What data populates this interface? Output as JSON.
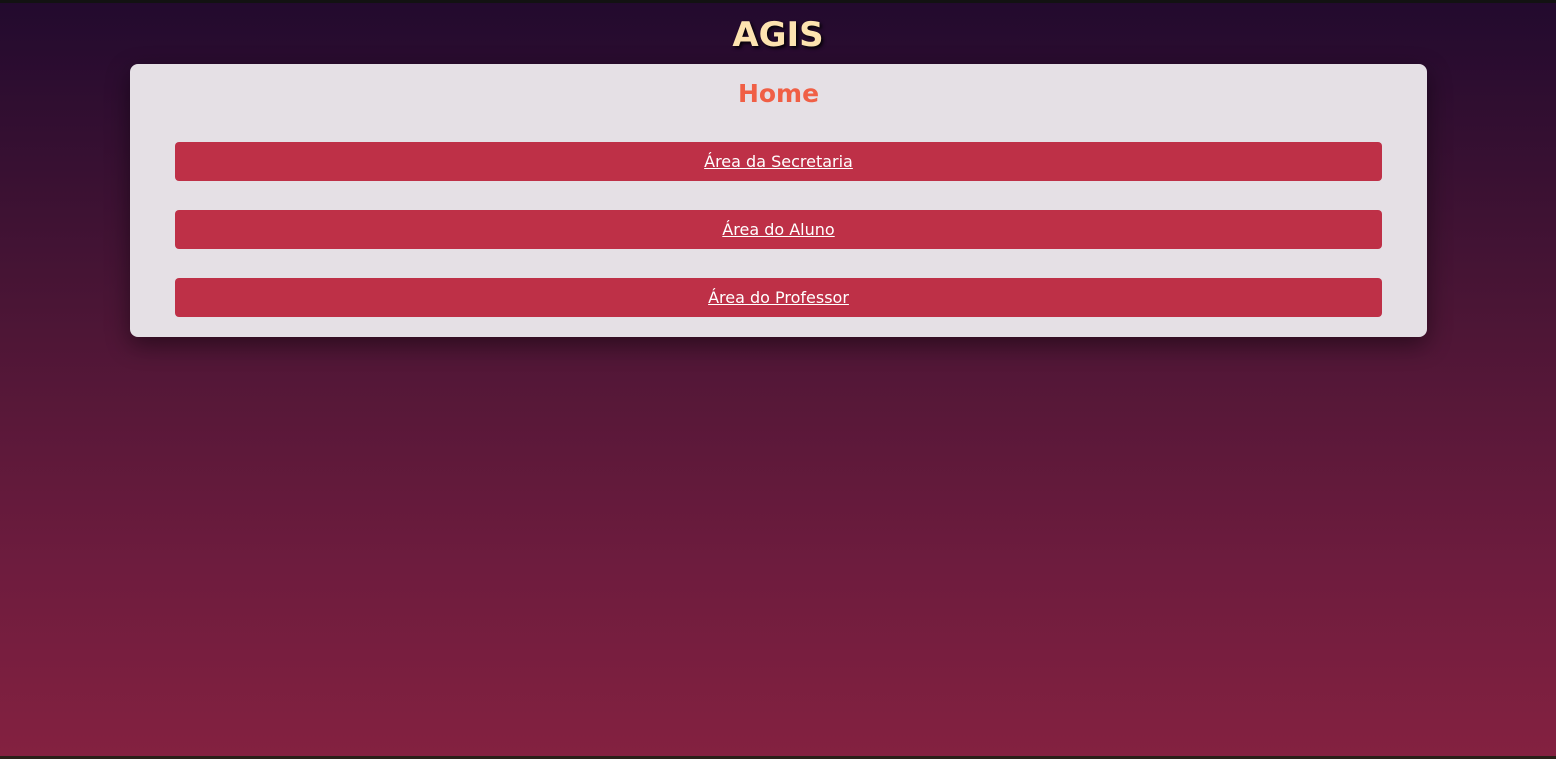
{
  "app": {
    "title": "AGIS"
  },
  "page": {
    "title": "Home"
  },
  "nav": {
    "items": [
      {
        "label": "Área da Secretaria"
      },
      {
        "label": "Área do Aluno"
      },
      {
        "label": "Área do Professor"
      }
    ]
  },
  "colors": {
    "title_text": "#fde3b0",
    "heading": "#f05f45",
    "button": "#be3047",
    "card": "#e5e0e5",
    "background_top": "#220a2e",
    "background_bottom": "#842140"
  }
}
